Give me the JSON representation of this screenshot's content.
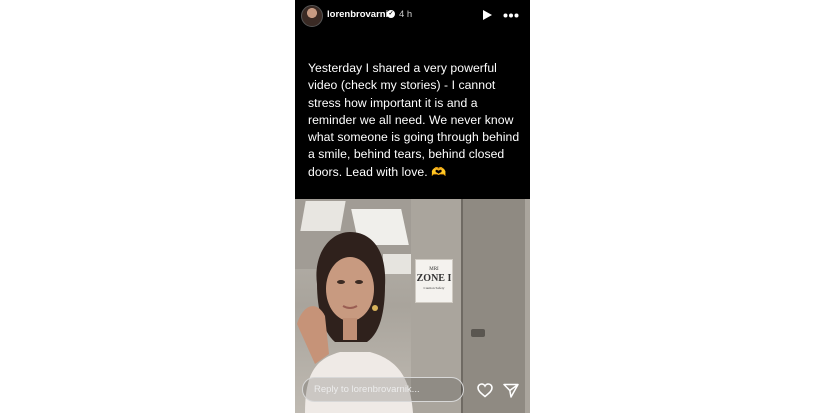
{
  "header": {
    "username": "lorenbrovarnik",
    "verified_mark": "✓",
    "time_ago": "4 h",
    "icons": [
      "avatar",
      "verified-icon",
      "play-icon",
      "more-icon"
    ]
  },
  "caption": "Yesterday I shared a very powerful video (check my stories) - I cannot stress how important it is and a reminder we all need. We never know what someone is going through behind a smile, behind tears, behind closed doors. Lead with love. 🫶",
  "photo": {
    "sign": {
      "line1": "MRI",
      "line2": "ZONE I",
      "line3": "Caution Safety"
    }
  },
  "reply": {
    "placeholder": "Reply to lorenbrovarnik..."
  },
  "actions": {
    "icons": [
      "heart-icon",
      "send-icon"
    ]
  },
  "colors": {
    "background": "#000000",
    "text": "#ffffff",
    "page": "#ffffff"
  }
}
